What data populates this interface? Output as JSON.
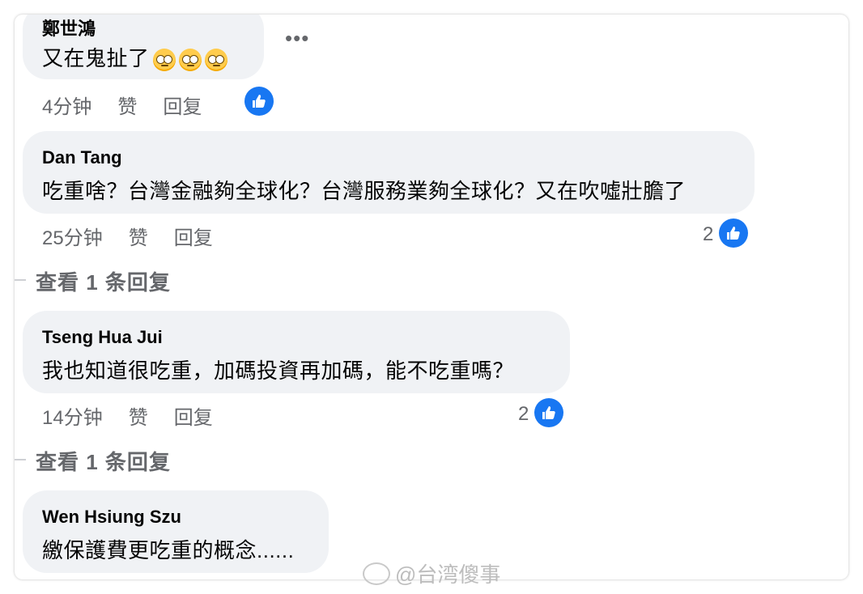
{
  "comments": [
    {
      "author": "鄭世鴻",
      "text": "又在鬼扯了",
      "emoji_count": 3,
      "time": "4分钟",
      "like_label": "赞",
      "reply_label": "回复",
      "like_count": ""
    },
    {
      "author": "Dan Tang",
      "text": "吃重啥？台灣金融夠全球化？台灣服務業夠全球化？又在吹噓壯膽了",
      "time": "25分钟",
      "like_label": "赞",
      "reply_label": "回复",
      "like_count": "2",
      "view_replies": "查看 1 条回复"
    },
    {
      "author": "Tseng Hua Jui",
      "text": "我也知道很吃重，加碼投資再加碼，能不吃重嗎？",
      "time": "14分钟",
      "like_label": "赞",
      "reply_label": "回复",
      "like_count": "2",
      "view_replies": "查看 1 条回复"
    },
    {
      "author": "Wen Hsiung Szu",
      "text": "繳保護費更吃重的概念......"
    }
  ],
  "more_options": "•••",
  "watermark": "@台湾傻事",
  "colors": {
    "like_blue": "#1877f2",
    "bubble_bg": "#f0f2f5",
    "meta_gray": "#65676b"
  },
  "icons": [
    "thumbs-up-icon",
    "more-options-icon",
    "eye-roll-emoji",
    "weibo-logo"
  ]
}
